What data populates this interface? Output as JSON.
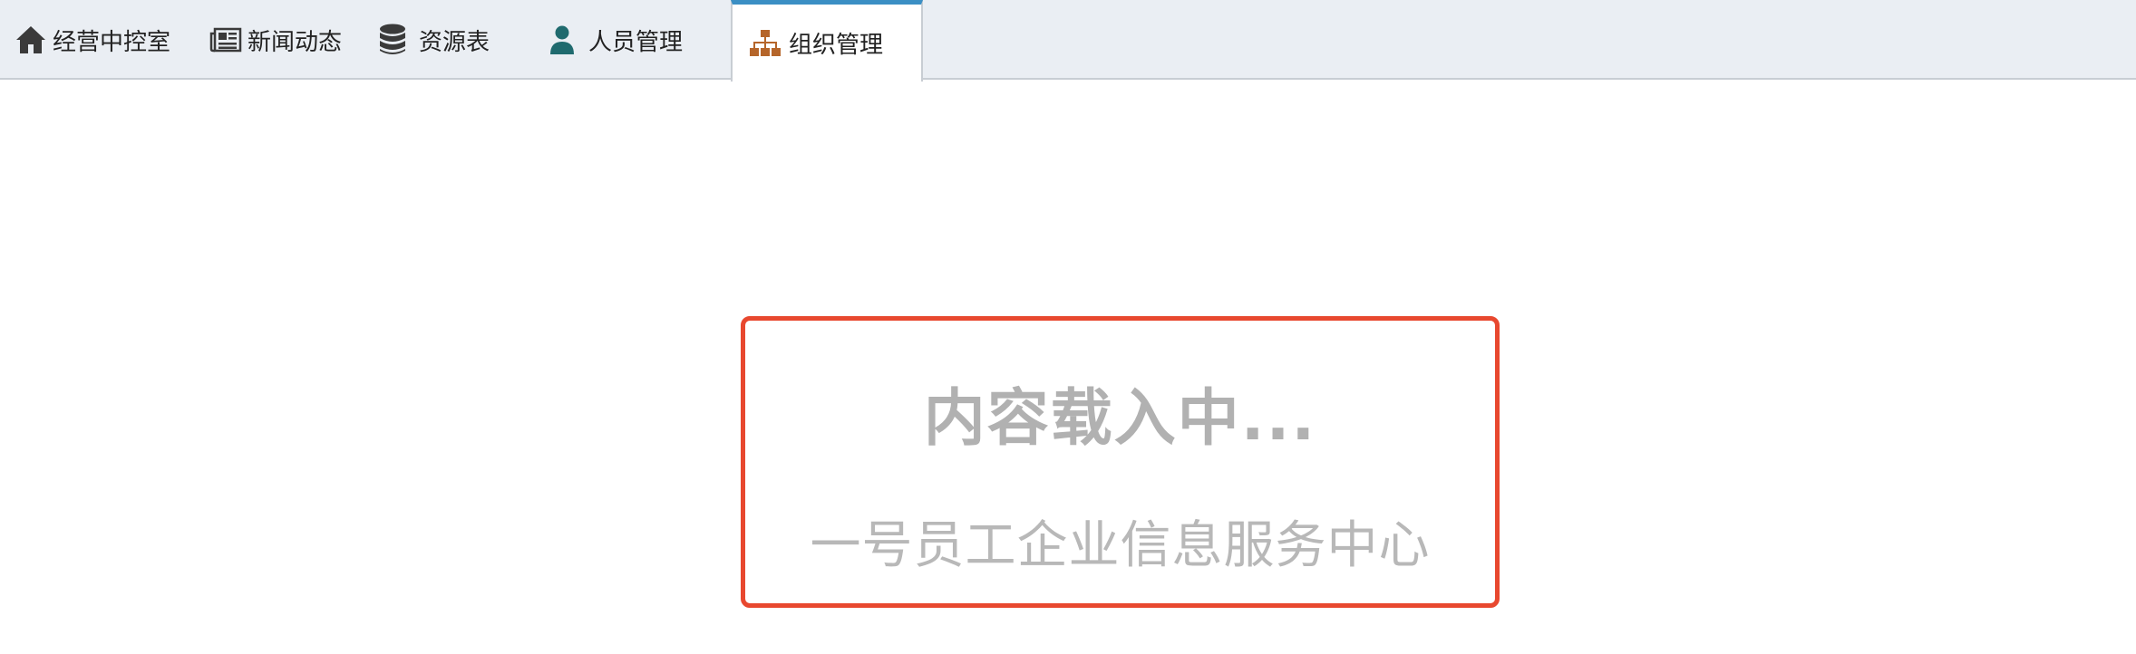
{
  "tabs": [
    {
      "label": "经营中控室",
      "icon": "home-icon",
      "active": false
    },
    {
      "label": "新闻动态",
      "icon": "newspaper-icon",
      "active": false
    },
    {
      "label": "资源表",
      "icon": "database-icon",
      "active": false
    },
    {
      "label": "人员管理",
      "icon": "user-icon",
      "active": false
    },
    {
      "label": "组织管理",
      "icon": "sitemap-icon",
      "active": true
    }
  ],
  "colors": {
    "tabbar_bg": "#eaeef3",
    "active_tab_indicator": "#3b8fc4",
    "user_icon": "#1f6a6e",
    "sitemap_icon": "#b5652a",
    "loading_border": "#e8482f",
    "loading_text": "#b1b1b1"
  },
  "loading": {
    "title": "内容载入中...",
    "subtitle": "一号员工企业信息服务中心"
  }
}
